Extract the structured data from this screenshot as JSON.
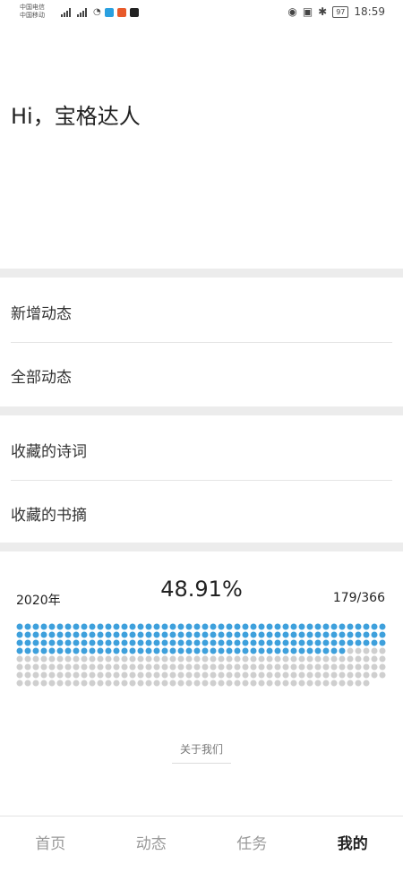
{
  "status_bar": {
    "carrier_1": "中国电信",
    "carrier_2": "中国移动",
    "time": "18:59",
    "battery": "97"
  },
  "greeting": "Hi，宝格达人",
  "menu": [
    {
      "label": "新增动态"
    },
    {
      "label": "全部动态"
    },
    {
      "label": "收藏的诗词"
    },
    {
      "label": "收藏的书摘"
    }
  ],
  "progress": {
    "year": "2020年",
    "percent": "48.91%",
    "count": "179/366",
    "filled": 179,
    "total": 366,
    "filled_color": "#3ea0dc",
    "empty_color": "#cfcfcf"
  },
  "about_label": "关于我们",
  "tabs": [
    {
      "label": "首页"
    },
    {
      "label": "动态"
    },
    {
      "label": "任务"
    },
    {
      "label": "我的"
    }
  ]
}
